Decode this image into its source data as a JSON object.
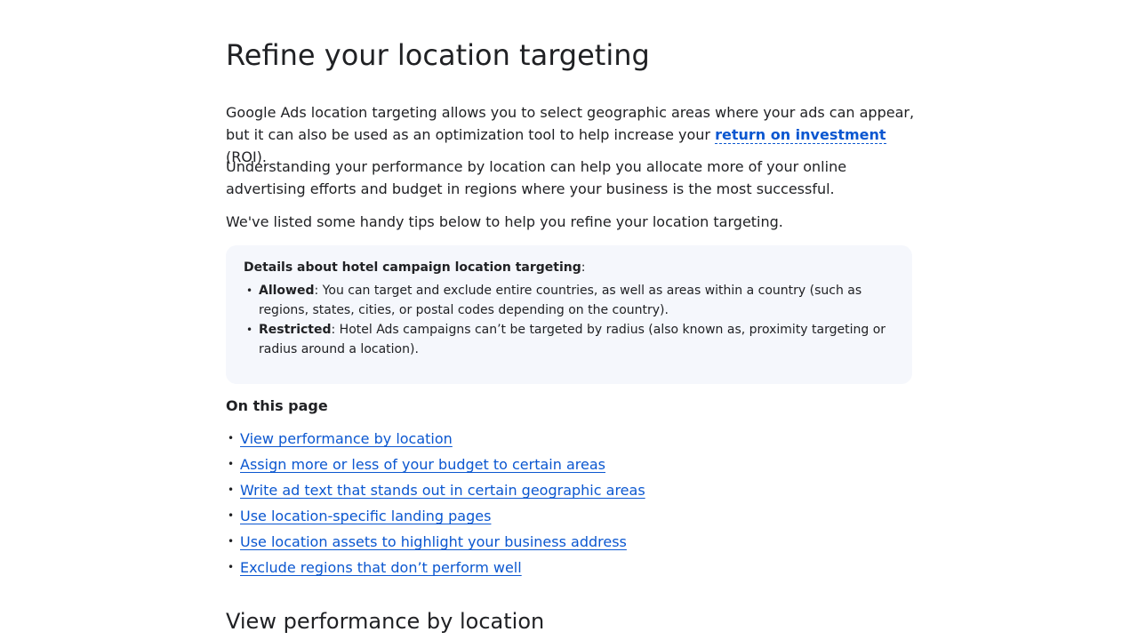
{
  "title": "Refine your location targeting",
  "intro": {
    "p1_before": "Google Ads location targeting allows you to select geographic areas where your ads can appear, but it can also be used as an optimization tool to help increase your ",
    "p1_link": "return on investment",
    "p1_after": " (ROI).",
    "p2": "Understanding your performance by location can help you allocate more of your online advertising efforts and budget in regions where your business is the most successful.",
    "p3": "We've listed some handy tips below to help you refine your location targeting."
  },
  "callout": {
    "title_bold": "Details about hotel campaign location targeting",
    "title_suffix": ":",
    "items": [
      {
        "label": "Allowed",
        "text": ": You can target and exclude entire countries, as well as areas within a country (such as regions, states, cities, or postal codes depending on the country)."
      },
      {
        "label": "Restricted",
        "text": ": Hotel Ads campaigns can’t be targeted by radius (also known as, proximity targeting or radius around a location)."
      }
    ]
  },
  "toc": {
    "title": "On this page",
    "links": [
      "View performance by location",
      "Assign more or less of your budget to certain areas",
      "Write ad text that stands out in certain geographic areas",
      "Use location-specific landing pages",
      "Use location assets to highlight your business address",
      "Exclude regions that don’t perform well"
    ]
  },
  "section_heading": "View performance by location",
  "colors": {
    "link": "#0b57d0",
    "text": "#202124",
    "callout_bg": "#f5f7fc"
  }
}
